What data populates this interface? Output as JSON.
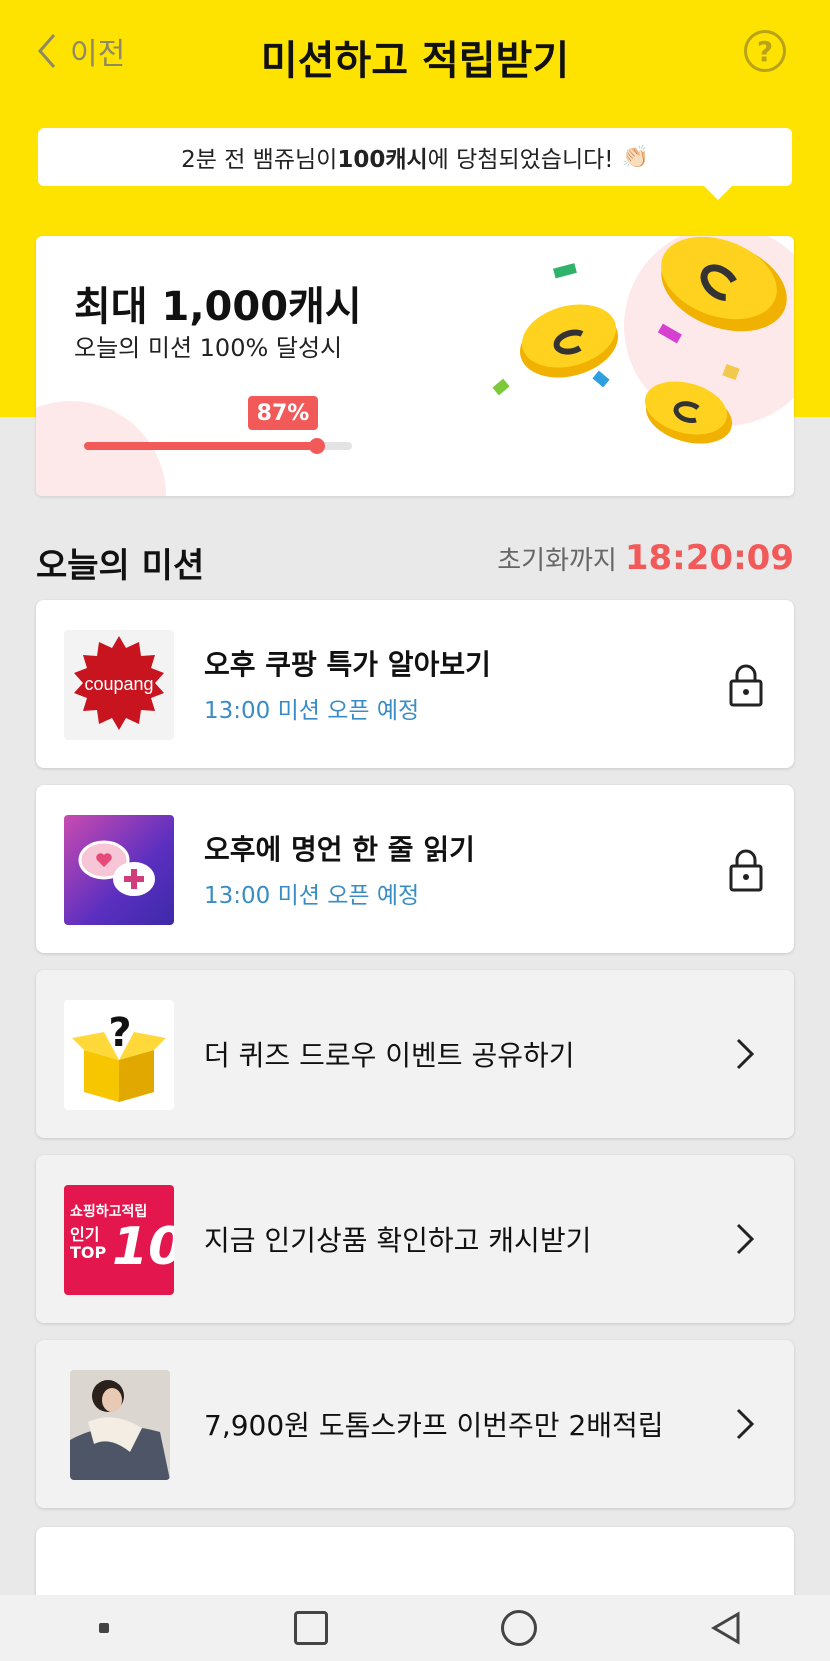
{
  "header": {
    "back_label": "이전",
    "title": "미션하고 적립받기",
    "help_label": "?"
  },
  "ticker": {
    "prefix": "2분 전 뱀쥬님이 ",
    "amount": "100캐시",
    "suffix": "에 당첨되었습니다!"
  },
  "hero": {
    "headline": "최대 1,000캐시",
    "subline": "오늘의 미션 100% 달성시",
    "progress_label": "87%",
    "progress_value": 87
  },
  "section": {
    "title": "오늘의 미션",
    "reset_label": "초기화까지",
    "reset_time": "18:20:09"
  },
  "missions": [
    {
      "title": "오후 쿠팡 특가 알아보기",
      "subtitle": "13:00 미션 오픈 예정",
      "thumb_text": "coupang",
      "status": "locked"
    },
    {
      "title": "오후에 명언 한 줄 읽기",
      "subtitle": "13:00 미션 오픈 예정",
      "status": "locked"
    },
    {
      "title": "더 퀴즈 드로우 이벤트 공유하기",
      "status": "open"
    },
    {
      "title": "지금 인기상품 확인하고 캐시받기",
      "thumb_line1": "쇼핑하고적립",
      "thumb_line2": "인기",
      "thumb_line3": "TOP",
      "thumb_num": "10",
      "status": "open"
    },
    {
      "title": "7,900원 도톰스카프 이번주만 2배적립",
      "status": "open"
    }
  ],
  "colors": {
    "brand_yellow": "#ffe300",
    "accent_red": "#f25a5a",
    "link_blue": "#3a8cc4"
  }
}
